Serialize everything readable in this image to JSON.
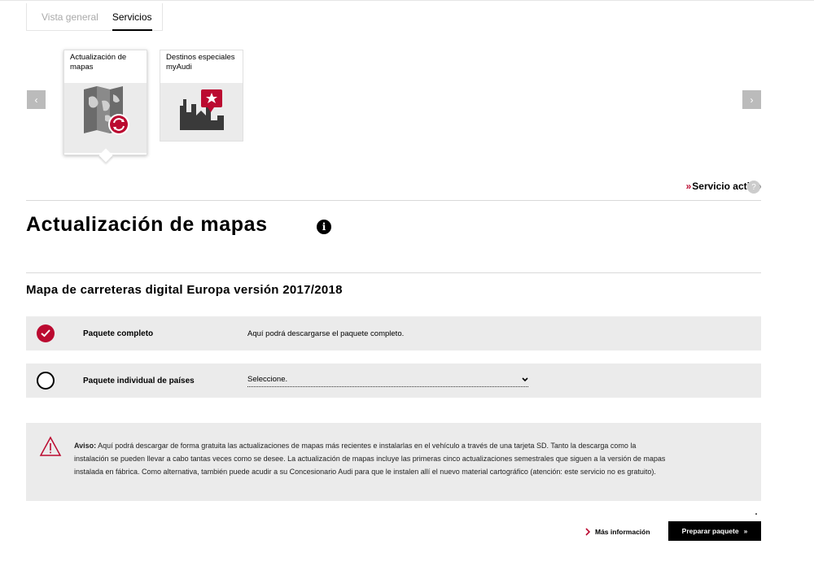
{
  "tabs": [
    {
      "label": "Vista general",
      "active": false
    },
    {
      "label": "Servicios",
      "active": true
    }
  ],
  "carousel": {
    "prev_icon": "chevron-left-icon",
    "next_icon": "chevron-right-icon",
    "prev_glyph": "‹",
    "next_glyph": "›",
    "cards": [
      {
        "label": "Actualización de mapas",
        "icon": "map-update-icon",
        "selected": true
      },
      {
        "label": "Destinos especiales myAudi",
        "icon": "special-destinations-icon",
        "selected": false
      }
    ]
  },
  "service_status": {
    "chevrons": "»",
    "label": "Servicio activo",
    "help_glyph": "?"
  },
  "page": {
    "title": "Actualización de mapas",
    "info_glyph": "i",
    "subtitle": "Mapa de carreteras digital Europa versión 2017/2018"
  },
  "options": [
    {
      "label": "Paquete completo",
      "description": "Aquí podrá descargarse el paquete completo.",
      "checked": true
    },
    {
      "label": "Paquete individual de países",
      "select_value": "Seleccione.",
      "checked": false
    }
  ],
  "notice": {
    "label": "Aviso:",
    "text": " Aquí podrá descargar de forma gratuita las actualizaciones de mapas más recientes e instalarlas en el vehículo a través de una tarjeta SD. Tanto la descarga como la instalación se pueden llevar a cabo tantas veces como se desee. La actualización de mapas incluye las primeras cinco actualizaciones semestrales que siguen a la versión de mapas instalada en fábrica. Como alternativa, también puede acudir a su Concesionario Audi para que le instalen allí el nuevo material cartográfico (atención: este servicio no es gratuito)."
  },
  "actions": {
    "more_info": "Más información",
    "prepare": "Preparar paquete",
    "prepare_chevrons": "»"
  },
  "colors": {
    "accent": "#bb0a30",
    "panel": "#ebebeb",
    "button": "#000000"
  }
}
